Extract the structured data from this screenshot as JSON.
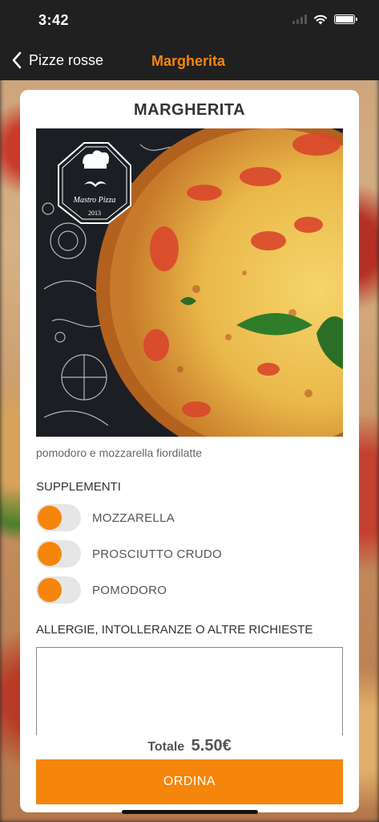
{
  "status_bar": {
    "time": "3:42"
  },
  "nav": {
    "back_label": "Pizze rosse",
    "title": "Margherita"
  },
  "product": {
    "name": "MARGHERITA",
    "logo_text": "Mastro Pizza",
    "logo_year": "2013",
    "description": "pomodoro e mozzarella fiordilatte"
  },
  "supplements": {
    "title": "SUPPLEMENTI",
    "items": [
      {
        "label": "MOZZARELLA"
      },
      {
        "label": "PROSCIUTTO CRUDO"
      },
      {
        "label": "POMODORO"
      }
    ]
  },
  "requests": {
    "title": "ALLERGIE, INTOLLERANZE O ALTRE RICHIESTE",
    "value": ""
  },
  "total": {
    "label": "Totale",
    "amount": "5.50€"
  },
  "order": {
    "button_label": "ORDINA"
  },
  "colors": {
    "accent": "#f5850b",
    "bar": "#202020"
  }
}
